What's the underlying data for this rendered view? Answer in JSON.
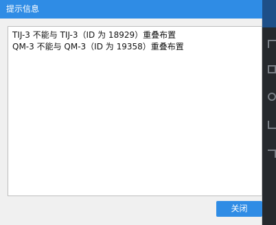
{
  "dialog": {
    "title": "提示信息",
    "messages": [
      "TIJ-3 不能与 TIJ-3（ID 为 18929）重叠布置",
      "QM-3 不能与 QM-3（ID 为 19358）重叠布置"
    ],
    "close_label": "关闭"
  },
  "colors": {
    "titlebar": "#2f8ce5",
    "button": "#2f8ce5",
    "dialog_background": "#f0f0f0",
    "message_background": "#ffffff",
    "side_strip": "#26292d"
  },
  "icons": [
    "corner-icon",
    "square-icon",
    "circle-icon",
    "bracket-icon",
    "angle-icon"
  ]
}
